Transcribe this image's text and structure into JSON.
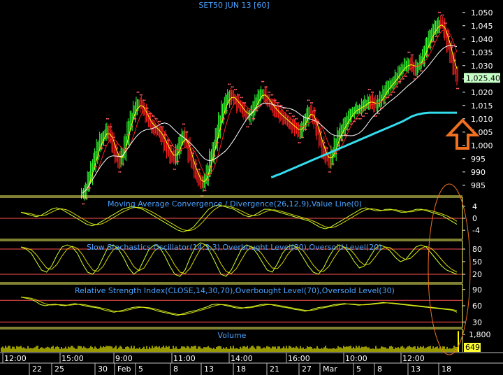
{
  "chart_data": [
    {
      "type": "line",
      "title": "SET50 JUN 13   [60]",
      "panel": "price",
      "y_ticks": [
        "1,050",
        "1,045",
        "1,040",
        "1,035",
        "1,030",
        "1,025",
        "1,020",
        "1,015",
        "1,010",
        "1,005",
        "1,000",
        "995",
        "990",
        "985"
      ],
      "ylim": [
        981,
        1051
      ],
      "last_price_label": "1,025.40",
      "last_price": 1025.4,
      "price_series": [
        982,
        984,
        988,
        992,
        996,
        1000,
        1003,
        1004,
        1006,
        1003,
        999,
        995,
        994,
        997,
        1002,
        1008,
        1011,
        1014,
        1016,
        1015,
        1013,
        1010,
        1008,
        1007,
        1006,
        1005,
        1003,
        1000,
        998,
        996,
        995,
        998,
        1002,
        1004,
        1001,
        996,
        993,
        989,
        987,
        985,
        987,
        991,
        996,
        1000,
        1005,
        1010,
        1014,
        1017,
        1019,
        1018,
        1017,
        1015,
        1014,
        1012,
        1011,
        1012,
        1014,
        1017,
        1019,
        1020,
        1018,
        1016,
        1015,
        1013,
        1012,
        1011,
        1010,
        1009,
        1008,
        1007,
        1006,
        1005,
        1007,
        1010,
        1013,
        1012,
        1009,
        1005,
        1001,
        997,
        995,
        994,
        997,
        1001,
        1004,
        1006,
        1008,
        1010,
        1012,
        1013,
        1014,
        1014,
        1015,
        1016,
        1017,
        1016,
        1015,
        1016,
        1018,
        1020,
        1022,
        1023,
        1024,
        1026,
        1028,
        1029,
        1030,
        1031,
        1030,
        1029,
        1030,
        1032,
        1035,
        1038,
        1041,
        1043,
        1045,
        1046,
        1045,
        1042,
        1037,
        1033,
        1028,
        1025.4
      ],
      "lt_ma_start_index": 62,
      "lt_ma_values": [
        988,
        988.3,
        988.7,
        989,
        989.4,
        989.8,
        990.2,
        990.6,
        991,
        991.4,
        991.8,
        992.2,
        992.6,
        993,
        993.4,
        993.8,
        994.2,
        994.6,
        995,
        995.4,
        995.8,
        996.2,
        996.6,
        997,
        997.4,
        997.8,
        998.2,
        998.6,
        999,
        999.4,
        999.8,
        1000.2,
        1000.6,
        1001,
        1001.4,
        1001.8,
        1002.2,
        1002.6,
        1003,
        1003.4,
        1003.8,
        1004.2,
        1004.6,
        1005,
        1005.4,
        1005.8,
        1006.2,
        1006.6,
        1007,
        1007.4,
        1007.8,
        1008.2,
        1008.6,
        1009,
        1009.5,
        1010,
        1010.5,
        1011,
        1011.3,
        1011.6,
        1011.8,
        1012,
        1012.1,
        1012.2,
        1012.3,
        1012.3,
        1012.3,
        1012.3,
        1012.3,
        1012.3,
        1012.3,
        1012.3,
        1012.3,
        1012.3,
        1012.3,
        1012.3
      ]
    },
    {
      "type": "line",
      "title": "Moving Average Convergence / Divergence(26,12,9),Value Line(0)",
      "y_ticks": [
        "4",
        "0",
        "-4"
      ],
      "ylim": [
        -7,
        7
      ],
      "values": [
        2,
        1.5,
        1,
        0.5,
        1,
        2,
        3,
        3.5,
        3,
        2,
        1,
        0,
        -1,
        -2,
        -2.5,
        -2,
        -1,
        0,
        1,
        2,
        3,
        3.5,
        4,
        3.5,
        3,
        2,
        1,
        0,
        -1,
        -2,
        -3,
        -4,
        -4.5,
        -4,
        -3,
        -1,
        1,
        3,
        4,
        4.5,
        4,
        3.5,
        3,
        2,
        1,
        0.5,
        1,
        2,
        3,
        3,
        2.5,
        2,
        1.5,
        1,
        0.5,
        0,
        -0.5,
        -1,
        -2,
        -3,
        -3.5,
        -3,
        -2,
        -1,
        0,
        1,
        2,
        3,
        3.5,
        3,
        2.5,
        2.5,
        3,
        3,
        2.5,
        2,
        2,
        2.5,
        3,
        3,
        2.5,
        2,
        1.5,
        1,
        0,
        -1,
        -2
      ]
    },
    {
      "type": "line",
      "title": "Slow Stochastics Oscillator(14,3,3),Overbought Level(80),Oversold Level(20)",
      "y_ticks": [
        "80",
        "50",
        "20"
      ],
      "ylim": [
        0,
        100
      ],
      "values": [
        85,
        80,
        70,
        50,
        30,
        25,
        40,
        65,
        85,
        90,
        85,
        70,
        45,
        25,
        20,
        35,
        60,
        85,
        90,
        80,
        60,
        35,
        20,
        30,
        55,
        80,
        90,
        85,
        65,
        40,
        20,
        15,
        30,
        60,
        85,
        95,
        90,
        70,
        45,
        20,
        15,
        30,
        55,
        80,
        90,
        85,
        70,
        50,
        30,
        25,
        45,
        70,
        85,
        90,
        80,
        60,
        40,
        25,
        20,
        35,
        60,
        80,
        90,
        85,
        70,
        50,
        35,
        40,
        60,
        80,
        90,
        85,
        75,
        60,
        50,
        55,
        70,
        85,
        90,
        85,
        70,
        55,
        40,
        30,
        25,
        20
      ]
    },
    {
      "type": "line",
      "title": "Relative Strength Index(CLOSE,14,30,70),Overbought Level(70),Oversold Level(30)",
      "y_ticks": [
        "90",
        "60",
        "30"
      ],
      "ylim": [
        20,
        100
      ],
      "values": [
        76,
        74,
        72,
        68,
        62,
        60,
        62,
        63,
        61,
        60,
        62,
        64,
        62,
        60,
        58,
        57,
        55,
        52,
        50,
        48,
        50,
        52,
        55,
        57,
        58,
        57,
        55,
        53,
        50,
        48,
        46,
        44,
        42,
        45,
        48,
        50,
        52,
        55,
        58,
        62,
        63,
        62,
        60,
        58,
        56,
        55,
        57,
        58,
        60,
        62,
        63,
        62,
        60,
        58,
        57,
        55,
        53,
        52,
        50,
        52,
        55,
        57,
        58,
        60,
        62,
        63,
        64,
        63,
        62,
        61,
        62,
        63,
        64,
        65,
        66,
        65,
        64,
        63,
        62,
        61,
        60,
        59,
        58,
        57,
        56,
        55,
        54,
        53,
        52,
        48
      ]
    },
    {
      "type": "bar",
      "title": "Volume",
      "y_ticks": [
        "1,800"
      ],
      "last_value_label": "649",
      "spike_ratio": 2.7
    }
  ],
  "x_axis": {
    "time_labels": [
      "12:00",
      "15:00",
      "9:00",
      "11:00",
      "14:00",
      "16:00",
      "10:00",
      "12:00"
    ],
    "date_labels": [
      "22",
      "25",
      "30",
      "Feb",
      "5",
      "8",
      "13",
      "18",
      "21",
      "27",
      "Mar",
      "5",
      "8",
      "13",
      "18"
    ]
  },
  "colors": {
    "background": "#000000",
    "price_up": "#33ff33",
    "price_down": "#ff2020",
    "fast_ma": "#ffff00",
    "slow_ma": "#ff2020",
    "mid_ma": "#ffffff",
    "parabolic_sar": "#ff6060",
    "long_ma": "#33ddee",
    "indicator_line": "#ccff33",
    "level_lines": "#ff5050",
    "panel_border": "#ffff66",
    "tick_text": "#ffffff",
    "last_price_bg": "#c8ffc8",
    "volume": "#ffff00",
    "annotation": "#f07020"
  },
  "annotations": {
    "arrow_icon": "up-arrow-icon",
    "ellipse": "highlight-ellipse"
  }
}
